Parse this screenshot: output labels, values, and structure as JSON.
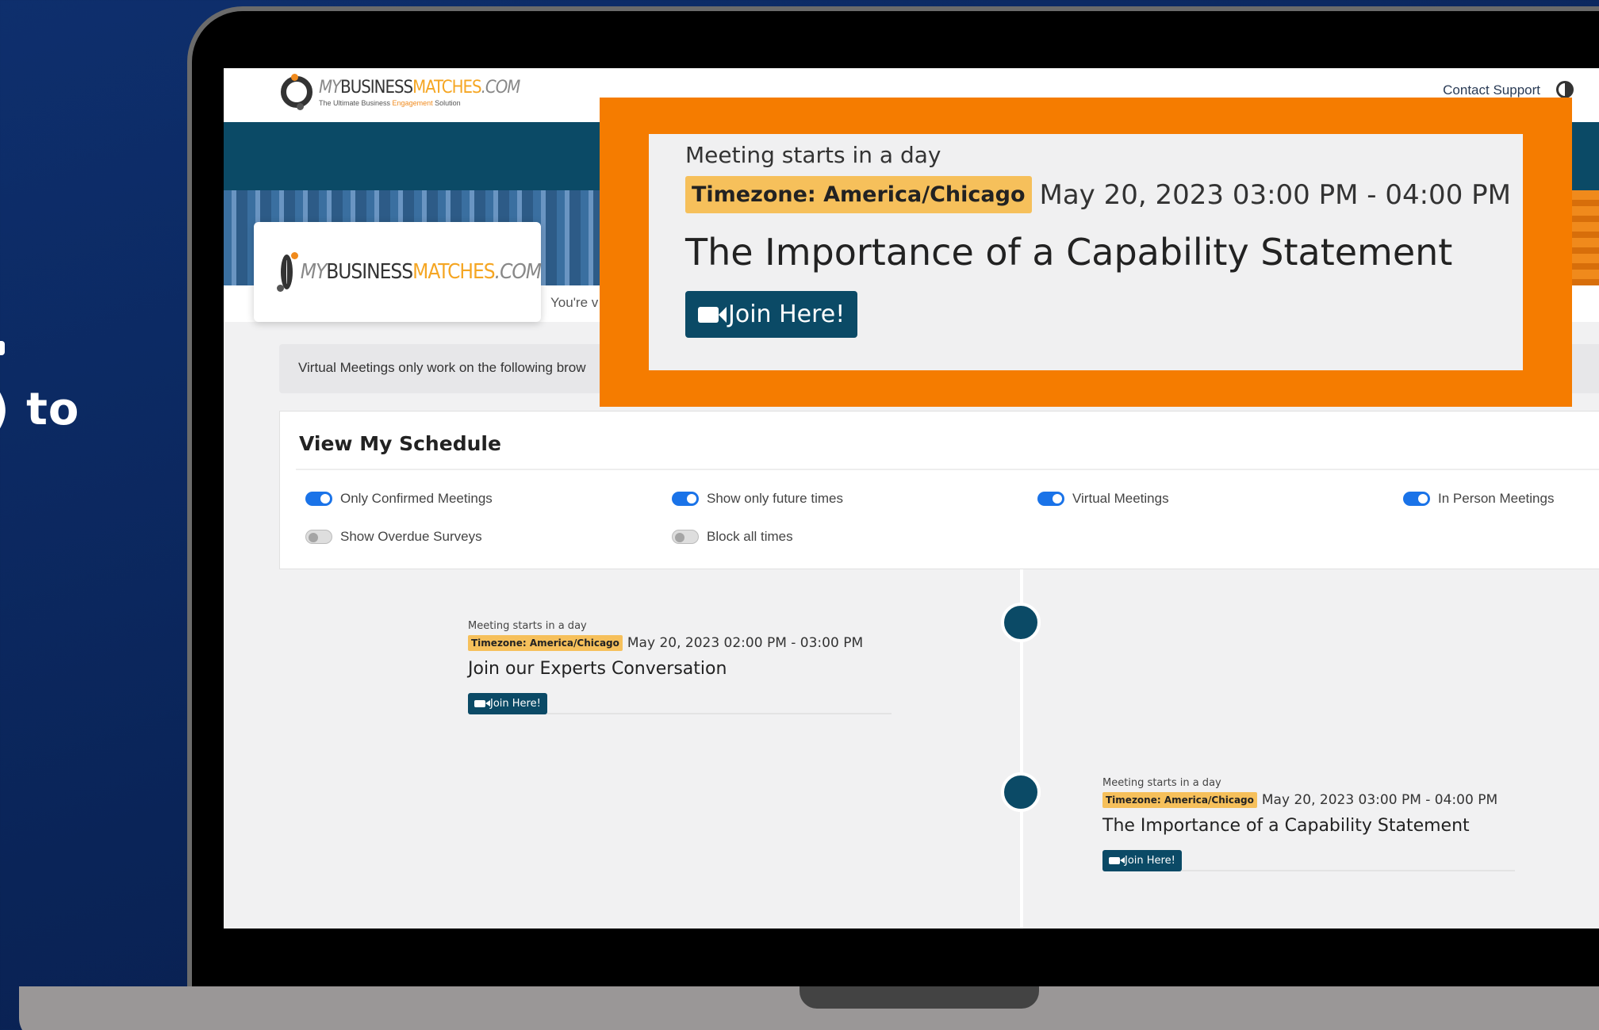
{
  "side_text": ") to",
  "header": {
    "logo_my": "MY",
    "logo_business": "BUSINESS",
    "logo_matches": "MATCHES",
    "logo_com": ".COM",
    "logo_tagline_1": "The Ultimate Business ",
    "logo_tagline_eng": "Engagement",
    "logo_tagline_2": " Solution",
    "contact_support": "Contact Support"
  },
  "profile": {
    "welcome_partial": "You're v"
  },
  "notice": {
    "text": "Virtual Meetings only work on the following brow"
  },
  "schedule": {
    "title": "View My Schedule",
    "toggles": [
      {
        "label": "Only Confirmed Meetings",
        "on": true
      },
      {
        "label": "Show only future times",
        "on": true
      },
      {
        "label": "Virtual Meetings",
        "on": true
      },
      {
        "label": "In Person Meetings",
        "on": true
      },
      {
        "label": "Show Overdue Surveys",
        "on": false
      },
      {
        "label": "Block all times",
        "on": false
      }
    ]
  },
  "meetings": [
    {
      "starts": "Meeting starts in a day",
      "timezone": "Timezone: America/Chicago",
      "datetime": "May 20, 2023 02:00 PM - 03:00 PM",
      "title": "Join our Experts Conversation",
      "join_label": "Join Here!"
    },
    {
      "starts": "Meeting starts in a day",
      "timezone": "Timezone: America/Chicago",
      "datetime": "May 20, 2023 03:00 PM - 04:00 PM",
      "title": "The Importance of a Capability Statement",
      "join_label": "Join Here!"
    }
  ],
  "callout": {
    "starts": "Meeting starts in a day",
    "timezone": "Timezone: America/Chicago",
    "datetime": "May 20, 2023 03:00 PM - 04:00 PM",
    "title": "The Importance of a Capability Statement",
    "join_label": "Join Here!"
  },
  "colors": {
    "background": "#0a2458",
    "primary": "#0b4a66",
    "accent_orange": "#f57c00",
    "badge": "#f6c05b",
    "toggle_on": "#1a73e8"
  }
}
